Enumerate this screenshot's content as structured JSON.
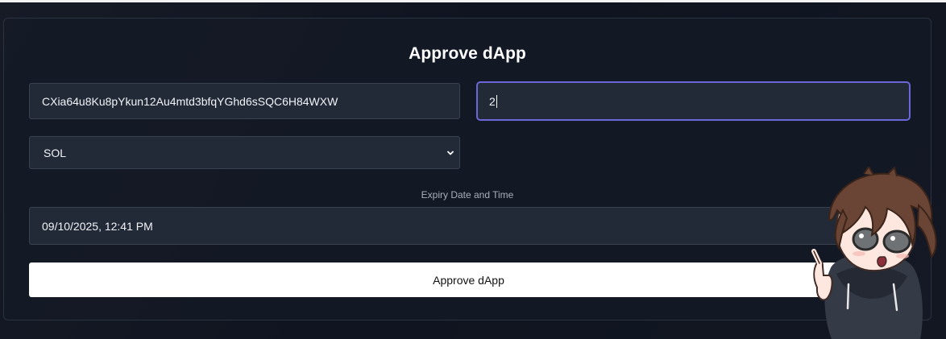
{
  "form": {
    "title": "Approve dApp",
    "address_value": "CXia64u8Ku8pYkun12Au4mtd3bfqYGhd6sSQC6H84WXW",
    "amount_value": "2",
    "token_selected": "SOL",
    "expiry_label": "Expiry Date and Time",
    "expiry_value": "09/10/2025, 12:41 PM",
    "submit_label": "Approve dApp"
  },
  "icons": {
    "select_chevron": "chevron-down-icon",
    "mascot": "anime-mascot-icon"
  },
  "colors": {
    "background": "#101520",
    "panel": "#141a26",
    "input": "#222a37",
    "focus_ring": "#6b67d9",
    "button": "#ffffff"
  }
}
